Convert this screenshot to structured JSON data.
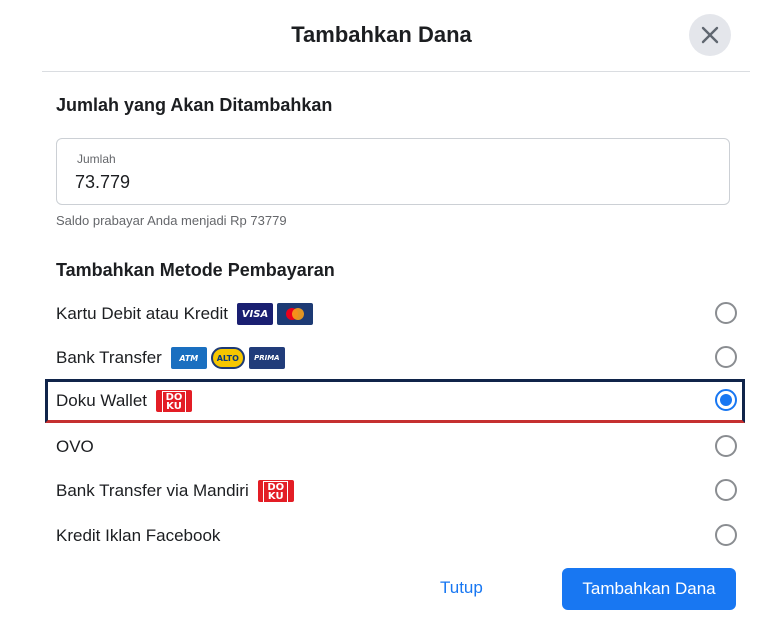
{
  "dialog": {
    "title": "Tambahkan Dana",
    "close_icon": "close-icon"
  },
  "amount_section": {
    "title": "Jumlah yang Akan Ditambahkan",
    "field_label": "Jumlah",
    "field_value": "73.779",
    "helper_text": "Saldo prabayar Anda menjadi Rp 73779"
  },
  "payment_section": {
    "title": "Tambahkan Metode Pembayaran",
    "methods": [
      {
        "label": "Kartu Debit atau Kredit",
        "logos": [
          "visa-logo",
          "mastercard-logo"
        ],
        "selected": false
      },
      {
        "label": "Bank Transfer",
        "logos": [
          "atm-bersama-logo",
          "alto-logo",
          "prima-logo"
        ],
        "selected": false
      },
      {
        "label": "Doku Wallet",
        "logos": [
          "doku-logo"
        ],
        "selected": true
      },
      {
        "label": "OVO",
        "logos": [],
        "selected": false
      },
      {
        "label": "Bank Transfer via Mandiri",
        "logos": [
          "doku-logo"
        ],
        "selected": false
      },
      {
        "label": "Kredit Iklan Facebook",
        "logos": [],
        "selected": false
      }
    ],
    "logo_text": {
      "visa": "VISA",
      "atm": "ATM",
      "alto": "ALTO",
      "prima": "PRIMA",
      "doku_top": "DO",
      "doku_bottom": "KU"
    }
  },
  "footer": {
    "close_label": "Tutup",
    "submit_label": "Tambahkan Dana"
  },
  "colors": {
    "primary": "#1877f2",
    "selected_border": "#10244a",
    "doku_red": "#e31d25"
  }
}
